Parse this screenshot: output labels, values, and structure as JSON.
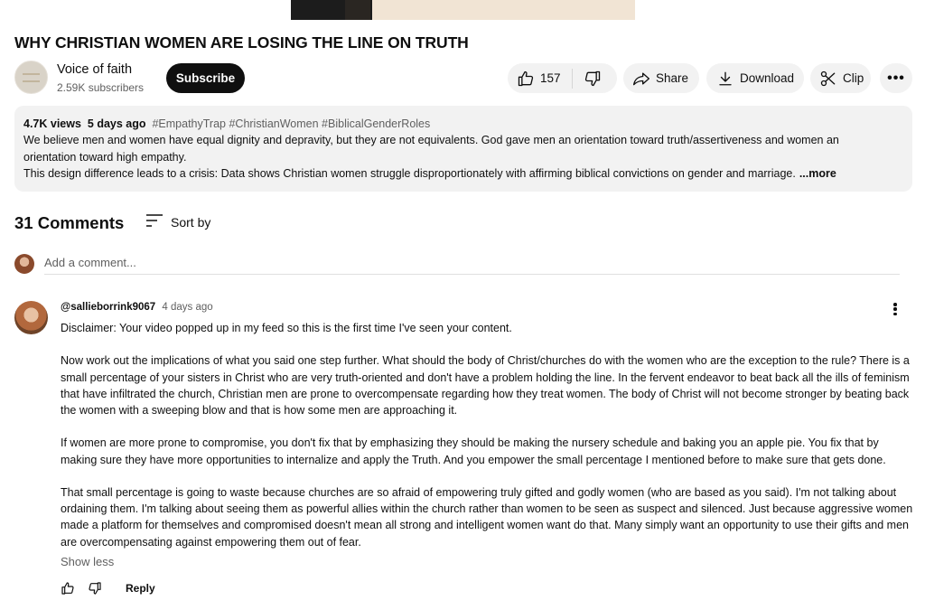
{
  "video": {
    "title": "WHY CHRISTIAN WOMEN ARE LOSING THE LINE ON TRUTH"
  },
  "channel": {
    "name": "Voice of faith",
    "subscribers": "2.59K subscribers",
    "subscribe_label": "Subscribe"
  },
  "actions": {
    "like_count": "157",
    "share_label": "Share",
    "download_label": "Download",
    "clip_label": "Clip",
    "more_label": "•••"
  },
  "description": {
    "views": "4.7K views",
    "age": "5 days ago",
    "tags": "#EmpathyTrap #ChristianWomen #BiblicalGenderRoles",
    "line1": "We believe men and women have equal dignity and depravity, but they are not equivalents. God gave men an orientation toward truth/assertiveness and women an",
    "line2": "orientation toward high empathy.",
    "line3": "This design difference leads to a crisis: Data shows Christian women struggle disproportionately with affirming biblical convictions on gender and marriage.",
    "more_label": "...more"
  },
  "comments": {
    "count_label": "31 Comments",
    "sort_label": "Sort by",
    "add_placeholder": "Add a comment...",
    "items": [
      {
        "handle": "@sallieborrink9067",
        "time": "4 days ago",
        "paragraphs": [
          "Disclaimer: Your video popped up in my feed so this is the first time I've seen your content.",
          "Now work out the implications of what you said one step further. What should the body of Christ/churches do with the women who are the exception to the rule? There is a small percentage of your sisters in Christ who are very truth-oriented and don't have a problem holding the line. In the fervent endeavor to beat back all the ills of feminism that have infiltrated the church, Christian men are prone to overcompensate regarding how they treat women. The body of Christ will not become stronger by beating back the women with a sweeping blow and that is how some men are approaching it.",
          "If women are more prone to compromise, you don't fix that by emphasizing they should be making the nursery schedule and baking you an apple pie. You fix that by making sure they have more opportunities to internalize and apply the Truth. And you empower the small percentage I mentioned before to make sure that gets done.",
          "That small percentage is going to waste because churches are so afraid of empowering truly gifted and godly women (who are based as you said). I'm not talking about ordaining them. I'm talking about seeing them as powerful allies within the church rather than women to be seen as suspect and silenced. Just because aggressive women made a platform for themselves and compromised doesn't mean all strong and intelligent women want do that. Many simply want an opportunity to use their gifts and men are overcompensating against empowering them out of fear."
        ],
        "show_less_label": "Show less",
        "reply_label": "Reply"
      }
    ]
  }
}
